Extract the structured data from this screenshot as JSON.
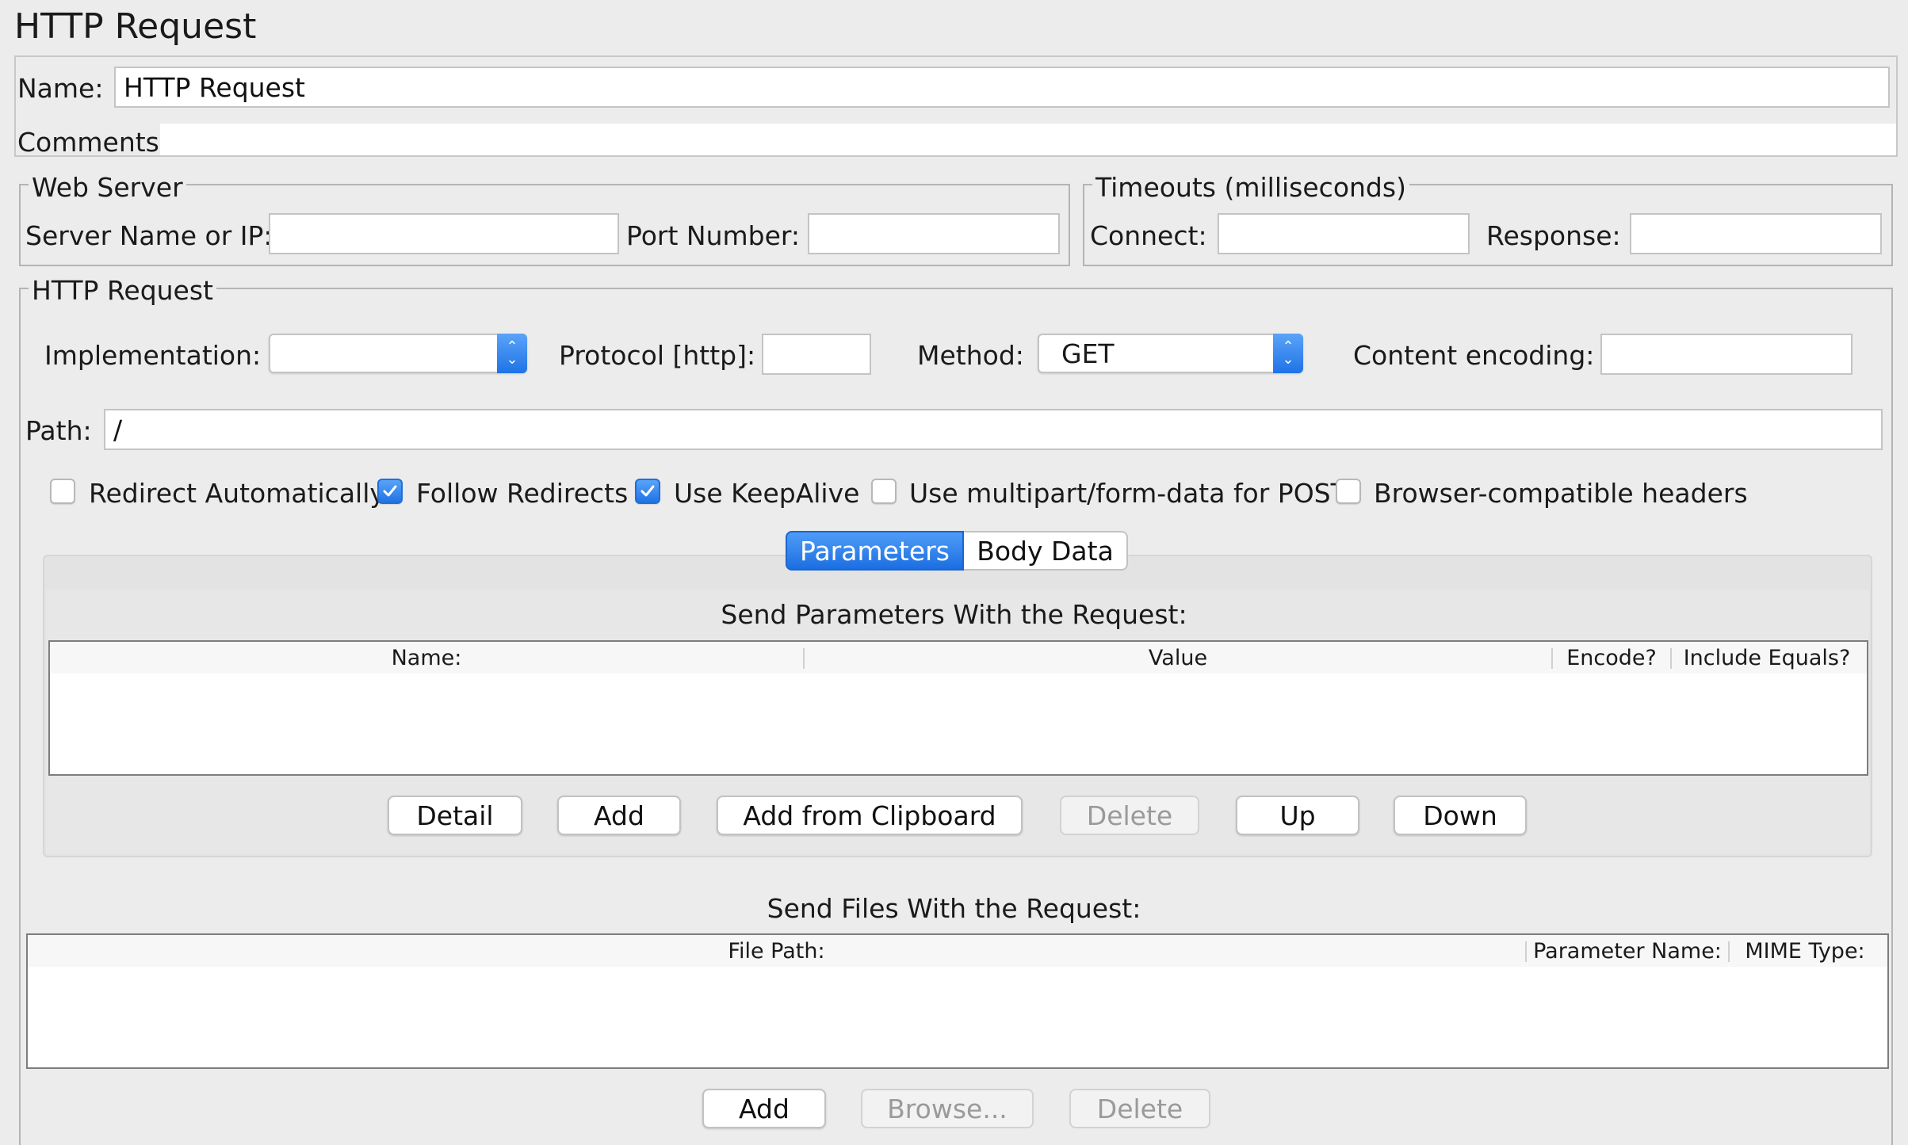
{
  "panel_title": "HTTP Request",
  "name_label": "Name:",
  "name_value": "HTTP Request",
  "comments_label": "Comments:",
  "comments_value": "",
  "web_server": {
    "legend": "Web Server",
    "server_label": "Server Name or IP:",
    "server_value": "",
    "port_label": "Port Number:",
    "port_value": ""
  },
  "timeouts": {
    "legend": "Timeouts (milliseconds)",
    "connect_label": "Connect:",
    "connect_value": "",
    "response_label": "Response:",
    "response_value": ""
  },
  "http_request": {
    "legend": "HTTP Request",
    "implementation_label": "Implementation:",
    "implementation_value": "",
    "protocol_label": "Protocol [http]:",
    "protocol_value": "",
    "method_label": "Method:",
    "method_value": "GET",
    "encoding_label": "Content encoding:",
    "encoding_value": "",
    "path_label": "Path:",
    "path_value": "/"
  },
  "options": [
    {
      "label": "Redirect Automatically",
      "checked": false
    },
    {
      "label": "Follow Redirects",
      "checked": true
    },
    {
      "label": "Use KeepAlive",
      "checked": true
    },
    {
      "label": "Use multipart/form-data for POST",
      "checked": false
    },
    {
      "label": "Browser-compatible headers",
      "checked": false
    }
  ],
  "tabs": [
    {
      "label": "Parameters",
      "active": true
    },
    {
      "label": "Body Data",
      "active": false
    }
  ],
  "params": {
    "heading": "Send Parameters With the Request:",
    "columns": [
      "Name:",
      "Value",
      "Encode?",
      "Include Equals?"
    ],
    "rows": [],
    "buttons": [
      {
        "label": "Detail",
        "enabled": true
      },
      {
        "label": "Add",
        "enabled": true
      },
      {
        "label": "Add from Clipboard",
        "enabled": true
      },
      {
        "label": "Delete",
        "enabled": false
      },
      {
        "label": "Up",
        "enabled": true
      },
      {
        "label": "Down",
        "enabled": true
      }
    ]
  },
  "files": {
    "heading": "Send Files With the Request:",
    "columns": [
      "File Path:",
      "Parameter Name:",
      "MIME Type:"
    ],
    "rows": [],
    "buttons": [
      {
        "label": "Add",
        "enabled": true
      },
      {
        "label": "Browse...",
        "enabled": false
      },
      {
        "label": "Delete",
        "enabled": false
      }
    ]
  },
  "colors": {
    "accent": "#1f73e6",
    "background": "#ececec"
  }
}
